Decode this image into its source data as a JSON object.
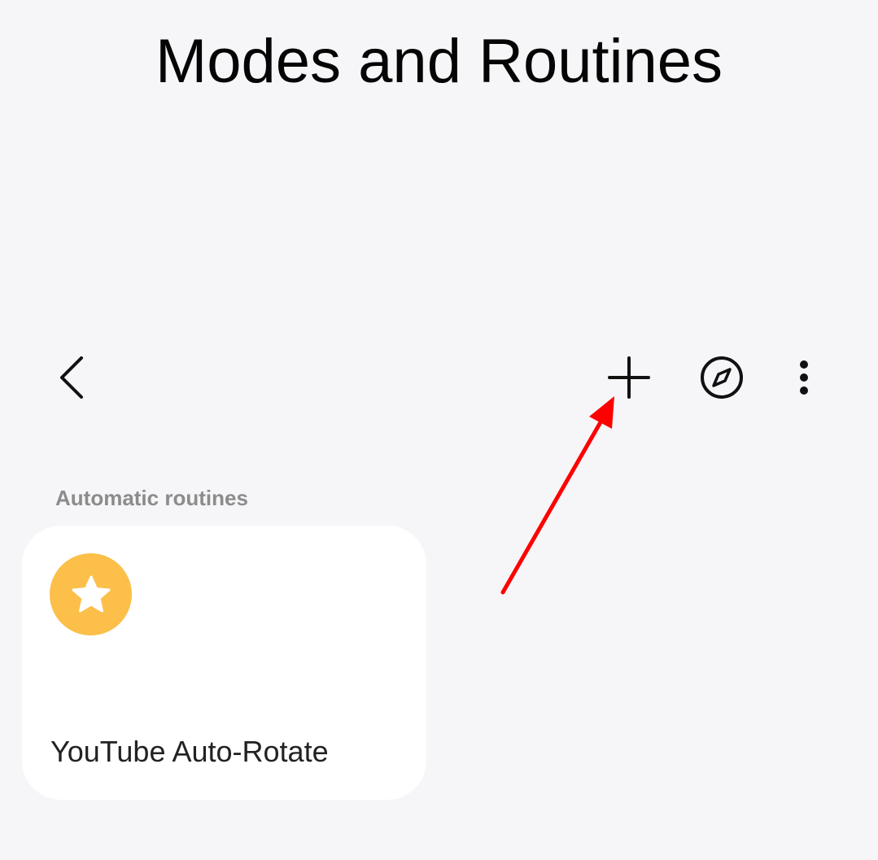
{
  "header": {
    "title": "Modes and Routines"
  },
  "toolbar": {
    "back_icon": "chevron-left-icon",
    "add_icon": "plus-icon",
    "discover_icon": "compass-icon",
    "more_icon": "more-vertical-icon"
  },
  "section": {
    "label": "Automatic routines"
  },
  "routines": [
    {
      "name": "YouTube Auto-Rotate",
      "icon": "star-icon",
      "icon_color": "#fbbf4a"
    }
  ],
  "annotation": {
    "arrow_color": "#ff0000",
    "points_to": "add-button"
  },
  "colors": {
    "background": "#f6f6f8",
    "card": "#ffffff",
    "section_label": "#8c8c8c"
  }
}
